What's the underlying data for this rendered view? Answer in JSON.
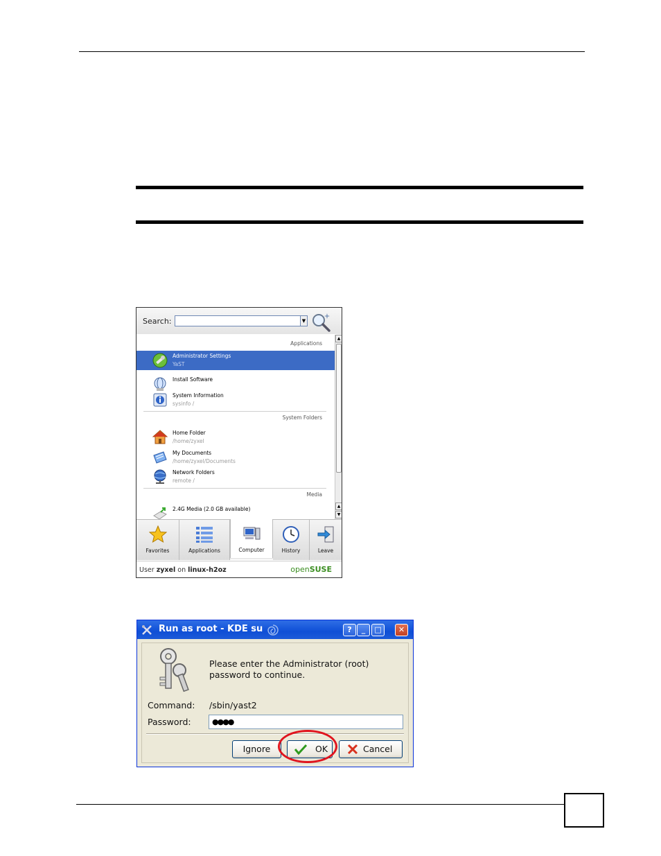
{
  "kde_menu": {
    "search_label": "Search:",
    "search_value": "",
    "sections": {
      "applications": "Applications",
      "system_folders": "System Folders",
      "media": "Media"
    },
    "items": [
      {
        "name": "Administrator Settings",
        "sub": "YaST",
        "selected": true,
        "icon": "admin-settings-icon"
      },
      {
        "name": "Install Software",
        "sub": "",
        "selected": false,
        "icon": "install-software-icon"
      },
      {
        "name": "System Information",
        "sub": "sysinfo /",
        "selected": false,
        "icon": "system-info-icon"
      },
      {
        "name": "Home Folder",
        "sub": "/home/zyxel",
        "selected": false,
        "icon": "home-folder-icon"
      },
      {
        "name": "My Documents",
        "sub": "/home/zyxel/Documents",
        "selected": false,
        "icon": "documents-icon"
      },
      {
        "name": "Network Folders",
        "sub": "remote /",
        "selected": false,
        "icon": "network-folder-icon"
      },
      {
        "name": "2.4G Media (2.0 GB available)",
        "sub": "",
        "selected": false,
        "icon": "media-icon"
      }
    ],
    "tabs": [
      {
        "label": "Favorites",
        "icon": "star-icon"
      },
      {
        "label": "Applications",
        "icon": "list-icon"
      },
      {
        "label": "Computer",
        "icon": "computer-icon",
        "active": true
      },
      {
        "label": "History",
        "icon": "clock-icon"
      },
      {
        "label": "Leave",
        "icon": "exit-icon"
      }
    ],
    "footer": {
      "prefix": "User ",
      "user": "zyxel",
      "middle": " on ",
      "host": "linux-h2oz",
      "logo_open": "open",
      "logo_suse": "SUSE"
    },
    "colors": {
      "selection": "#3c6bc5",
      "logo": "#3a8d20"
    }
  },
  "kdesu": {
    "title": "Run as root - KDE su",
    "title_buttons": {
      "help": "?",
      "minimize": "_",
      "maximize": "□",
      "close": "✕"
    },
    "prompt_line1": "Please enter the Administrator (root)",
    "prompt_line2": "password to continue.",
    "command_label": "Command:",
    "command_value": "/sbin/yast2",
    "password_label": "Password:",
    "password_value": "●●●●",
    "buttons": {
      "ignore": "Ignore",
      "ok": "OK",
      "cancel": "Cancel"
    },
    "colors": {
      "titlebar": "#0f4fd6",
      "highlight": "#e0141e"
    }
  }
}
